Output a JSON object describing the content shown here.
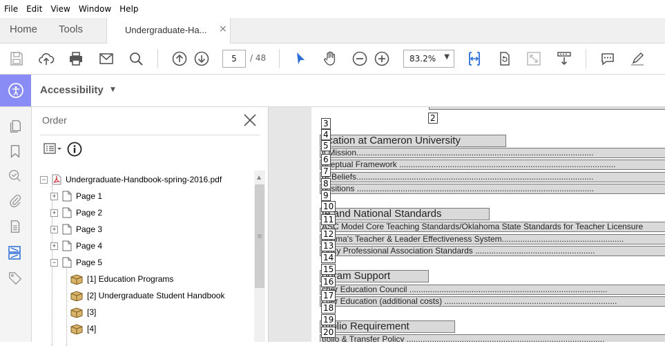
{
  "menu": [
    "File",
    "Edit",
    "View",
    "Window",
    "Help"
  ],
  "nav": {
    "home": "Home",
    "tools": "Tools"
  },
  "tab": {
    "title": "Undergraduate-Ha...",
    "close": "×"
  },
  "toolbar": {
    "page_current": "5",
    "page_total": "/ 48",
    "zoom": "83.2%"
  },
  "accessibility": {
    "title": "Accessibility"
  },
  "panel": {
    "title": "Order"
  },
  "tree": {
    "root": "Undergraduate-Handbook-spring-2016.pdf",
    "pages": [
      "Page 1",
      "Page 2",
      "Page 3",
      "Page 4",
      "Page 5"
    ],
    "children": [
      "[1]  Education Programs",
      "[2]  Undergraduate Student Handbook",
      "[3]",
      "[4]"
    ]
  },
  "doc": {
    "tags": [
      "2",
      "3",
      "4",
      "5",
      "6",
      "7",
      "8",
      "9",
      "10",
      "11",
      "12",
      "13",
      "14",
      "15",
      "16",
      "17",
      "18",
      "19",
      "20"
    ],
    "lines": [
      "ucation at Cameron University",
      "it Mission.......................................................................................................",
      "nceptual Framework ..............................................................................................",
      "re Beliefs.......................................................................................................",
      "positions .......................................................................................................",
      "te and National Standards",
      "ASC Model Core Teaching Standards/Oklahoma State Standards for Teacher Licensure",
      "ahoma's Teacher & Leader Effectiveness System.....................................................",
      "cialty Professional Association Standards ....................................................",
      "ogram Support",
      "cher Education Council ......................................................................................",
      "cher Education (additional costs) ...........................................................................",
      "rtfolio Requirement",
      "tfolio & Transfer Policy ......................................................................................"
    ]
  }
}
